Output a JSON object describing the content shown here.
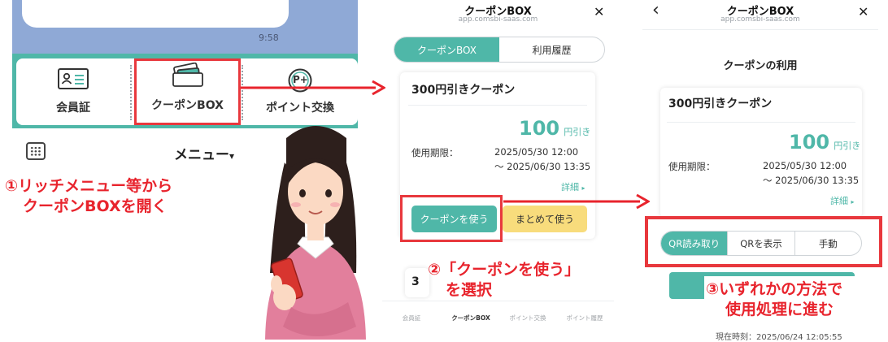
{
  "panel1": {
    "chat_time": "9:58",
    "rich_menu": {
      "items": [
        {
          "icon": "member-card-icon",
          "label": "会員証"
        },
        {
          "icon": "coupon-wallet-icon",
          "label": "クーポンBOX"
        },
        {
          "icon": "point-exchange-icon",
          "label": "ポイント交換",
          "icon_text": "P+"
        }
      ]
    },
    "menu_toggle": "メニュー",
    "menu_toggle_arrow": "▾",
    "step_text": [
      "①リッチメニュー等から",
      "クーポンBOXを開く"
    ]
  },
  "panel2": {
    "header_title": "クーポンBOX",
    "header_url": "app.comsbi-saas.com",
    "close": "✕",
    "tabs": [
      {
        "label": "クーポンBOX",
        "active": true
      },
      {
        "label": "利用履歴",
        "active": false
      }
    ],
    "coupon": {
      "title": "300円引きクーポン",
      "amount": "100",
      "amount_unit": "円引き",
      "expiry_label": "使用期限：",
      "expiry_start": "2025/05/30 12:00",
      "expiry_end": "〜 2025/06/30 13:35",
      "detail_link": "詳細",
      "detail_arrow": "▸"
    },
    "use_button": "クーポンを使う",
    "bulk_button": "まとめて使う",
    "partial_card_char": "3",
    "step_text": [
      "②「クーポンを使う」",
      "を選択"
    ],
    "bottom_tabs": [
      "会員証",
      "クーポンBOX",
      "ポイント交換",
      "ポイント履歴"
    ]
  },
  "panel3": {
    "back": "‹",
    "header_title": "クーポンBOX",
    "header_url": "app.comsbi-saas.com",
    "close": "✕",
    "page_title": "クーポンの利用",
    "coupon": {
      "title": "300円引きクーポン",
      "amount": "100",
      "amount_unit": "円引き",
      "expiry_label": "使用期限：",
      "expiry_start": "2025/05/30 12:00",
      "expiry_end": "〜 2025/06/30 13:35",
      "detail_link": "詳細",
      "detail_arrow": "▸"
    },
    "methods": [
      {
        "label": "QR読み取り",
        "active": true
      },
      {
        "label": "QRを表示",
        "active": false
      },
      {
        "label": "手動",
        "active": false
      }
    ],
    "step_text": [
      "③いずれかの方法で",
      "使用処理に進む"
    ],
    "footer_partial": "現在時刻：2025/06/24 12:05:55"
  },
  "colors": {
    "accent": "#4fb7a8",
    "annotation_red": "#e8383d",
    "chat_bg": "#8fa9d6",
    "bulk_yellow": "#f8dc7c"
  }
}
